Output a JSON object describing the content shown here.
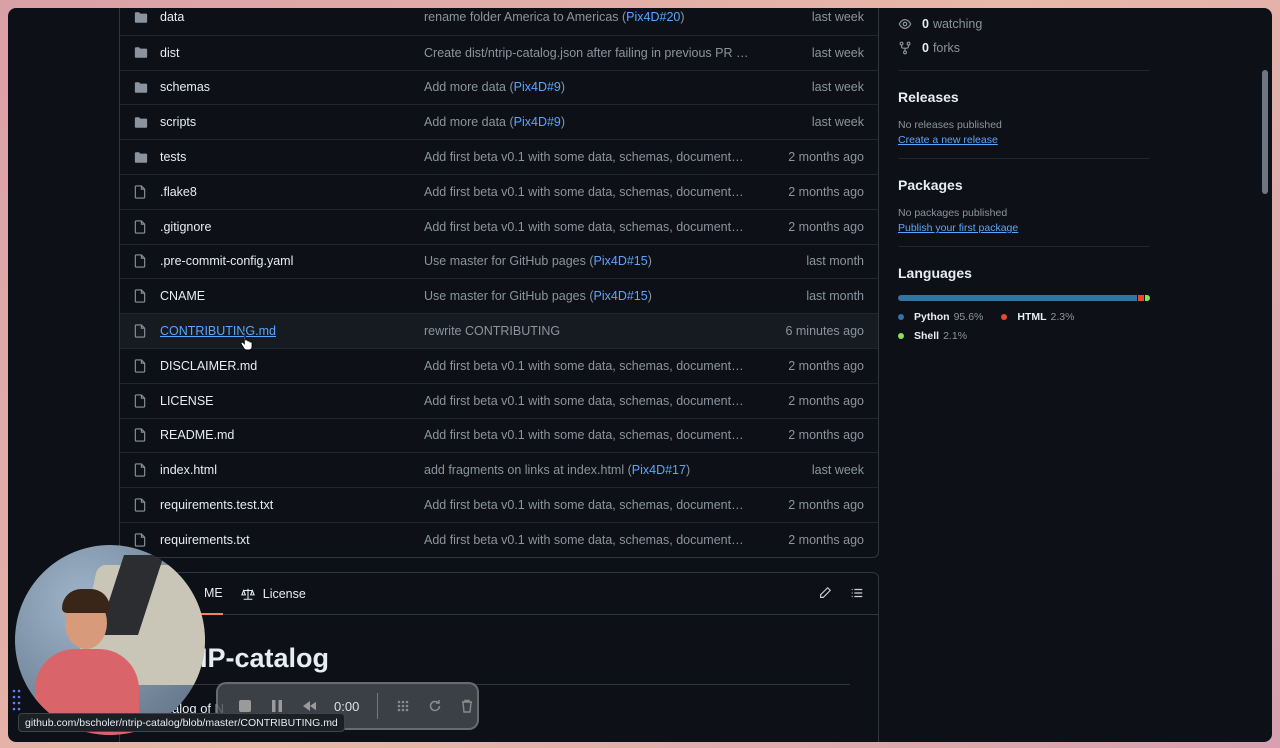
{
  "files": [
    {
      "type": "folder",
      "name": "data",
      "message": "rename folder America to Americas (",
      "ref": "Pix4D#20",
      "message_end": ")",
      "date": "last week"
    },
    {
      "type": "folder",
      "name": "dist",
      "message": "Create dist/ntrip-catalog.json after failing in previous PR (...",
      "ref": "",
      "message_end": "",
      "date": "last week"
    },
    {
      "type": "folder",
      "name": "schemas",
      "message": "Add more data (",
      "ref": "Pix4D#9",
      "message_end": ")",
      "date": "last week"
    },
    {
      "type": "folder",
      "name": "scripts",
      "message": "Add more data (",
      "ref": "Pix4D#9",
      "message_end": ")",
      "date": "last week"
    },
    {
      "type": "folder",
      "name": "tests",
      "message": "Add first beta v0.1 with some data, schemas, documentati...",
      "ref": "",
      "message_end": "",
      "date": "2 months ago"
    },
    {
      "type": "file",
      "name": ".flake8",
      "message": "Add first beta v0.1 with some data, schemas, documentati...",
      "ref": "",
      "message_end": "",
      "date": "2 months ago"
    },
    {
      "type": "file",
      "name": ".gitignore",
      "message": "Add first beta v0.1 with some data, schemas, documentati...",
      "ref": "",
      "message_end": "",
      "date": "2 months ago"
    },
    {
      "type": "file",
      "name": ".pre-commit-config.yaml",
      "message": "Use master for GitHub pages (",
      "ref": "Pix4D#15",
      "message_end": ")",
      "date": "last month"
    },
    {
      "type": "file",
      "name": "CNAME",
      "message": "Use master for GitHub pages (",
      "ref": "Pix4D#15",
      "message_end": ")",
      "date": "last month"
    },
    {
      "type": "file",
      "name": "CONTRIBUTING.md",
      "message": "rewrite CONTRIBUTING",
      "ref": "",
      "message_end": "",
      "date": "6 minutes ago",
      "hover": true
    },
    {
      "type": "file",
      "name": "DISCLAIMER.md",
      "message": "Add first beta v0.1 with some data, schemas, documentati...",
      "ref": "",
      "message_end": "",
      "date": "2 months ago"
    },
    {
      "type": "file",
      "name": "LICENSE",
      "message": "Add first beta v0.1 with some data, schemas, documentati...",
      "ref": "",
      "message_end": "",
      "date": "2 months ago"
    },
    {
      "type": "file",
      "name": "README.md",
      "message": "Add first beta v0.1 with some data, schemas, documentati...",
      "ref": "",
      "message_end": "",
      "date": "2 months ago"
    },
    {
      "type": "file",
      "name": "index.html",
      "message": "add fragments on links at index.html (",
      "ref": "Pix4D#17",
      "message_end": ")",
      "date": "last week"
    },
    {
      "type": "file",
      "name": "requirements.test.txt",
      "message": "Add first beta v0.1 with some data, schemas, documentati...",
      "ref": "",
      "message_end": "",
      "date": "2 months ago"
    },
    {
      "type": "file",
      "name": "requirements.txt",
      "message": "Add first beta v0.1 with some data, schemas, documentati...",
      "ref": "",
      "message_end": "",
      "date": "2 months ago"
    }
  ],
  "sidebar": {
    "watching_count": "0",
    "watching_label": "watching",
    "forks_count": "0",
    "forks_label": "forks",
    "releases_title": "Releases",
    "releases_none": "No releases published",
    "releases_link": "Create a new release",
    "packages_title": "Packages",
    "packages_none": "No packages published",
    "packages_link": "Publish your first package",
    "languages_title": "Languages",
    "languages": [
      {
        "name": "Python",
        "percent": "95.6%",
        "value": 95.6,
        "color": "#3572A5"
      },
      {
        "name": "HTML",
        "percent": "2.3%",
        "value": 2.3,
        "color": "#e34c26"
      },
      {
        "name": "Shell",
        "percent": "2.1%",
        "value": 2.1,
        "color": "#89e051"
      }
    ]
  },
  "readme": {
    "tab_readme_partial": "ME",
    "tab_license": "License",
    "title_partial": "IP-catalog",
    "para_partial": "alog of N"
  },
  "recorder": {
    "time": "0:00"
  },
  "status_url": "github.com/bscholer/ntrip-catalog/blob/master/CONTRIBUTING.md"
}
